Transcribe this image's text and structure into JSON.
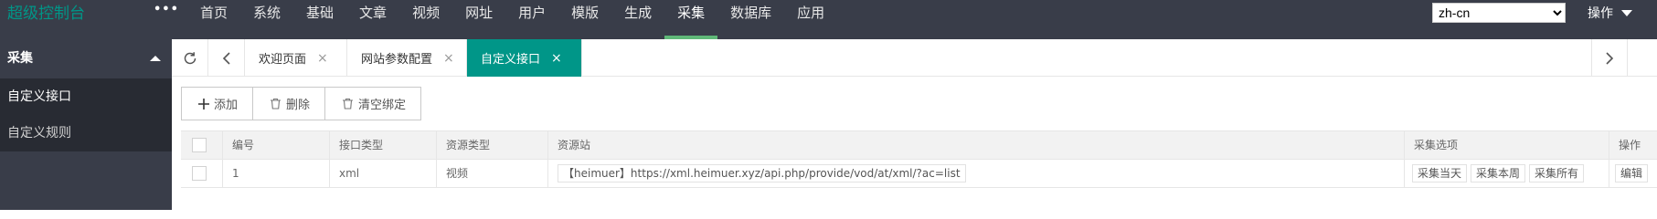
{
  "brand": "超级控制台",
  "more_label": "•••",
  "nav": [
    "首页",
    "系统",
    "基础",
    "文章",
    "视频",
    "网址",
    "用户",
    "模版",
    "生成",
    "采集",
    "数据库",
    "应用"
  ],
  "nav_active": "采集",
  "language": {
    "selected": "zh-cn"
  },
  "ops_label": "操作",
  "sidebar": {
    "section": "采集",
    "items": [
      {
        "label": "自定义接口"
      },
      {
        "label": "自定义规则"
      }
    ]
  },
  "tabs": [
    {
      "label": "欢迎页面"
    },
    {
      "label": "网站参数配置"
    },
    {
      "label": "自定义接口"
    }
  ],
  "close_glyph": "×",
  "toolbar": {
    "add": "添加",
    "delete": "删除",
    "clear": "清空绑定"
  },
  "table": {
    "headers": [
      "编号",
      "接口类型",
      "资源类型",
      "资源站",
      "采集选项",
      "操作"
    ],
    "rows": [
      {
        "id": "1",
        "api_type": "xml",
        "resource_type": "视频",
        "site": "【heimuer】https://xml.heimuer.xyz/api.php/provide/vod/at/xml/?ac=list",
        "options": [
          "采集当天",
          "采集本周",
          "采集所有"
        ],
        "action": "编辑"
      }
    ]
  }
}
